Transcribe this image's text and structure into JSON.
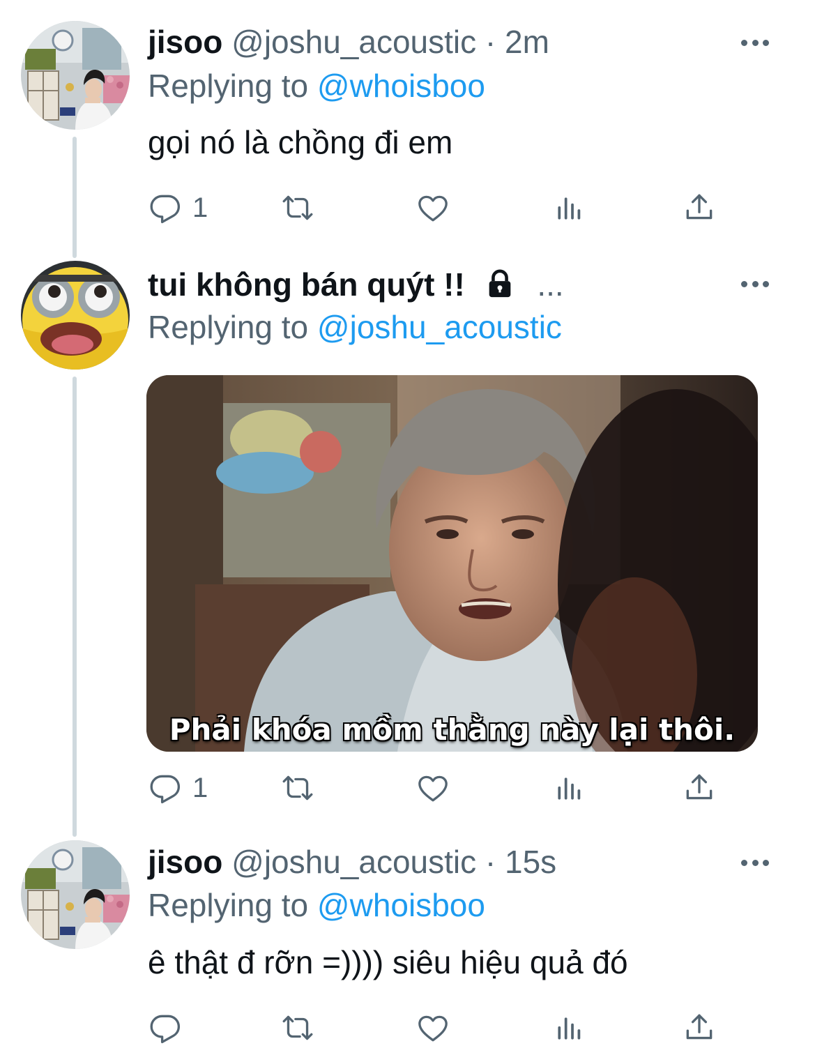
{
  "thread": [
    {
      "display_name": "jisoo",
      "handle": "@joshu_acoustic",
      "separator": "·",
      "time": "2m",
      "replying_prefix": "Replying to",
      "replying_to": "@whoisboo",
      "text": "gọi nó là chồng đi em",
      "reply_count": "1",
      "avatar_icon": "person-avatar"
    },
    {
      "display_name": "tui không bán quýt !!",
      "truncation": "...",
      "protected_icon": "lock-icon",
      "replying_prefix": "Replying to",
      "replying_to": "@joshu_acoustic",
      "media_caption": "Phải khóa mồm thằng này lại thôi.",
      "reply_count": "1",
      "avatar_icon": "cartoon-avatar"
    },
    {
      "display_name": "jisoo",
      "handle": "@joshu_acoustic",
      "separator": "·",
      "time": "15s",
      "replying_prefix": "Replying to",
      "replying_to": "@whoisboo",
      "text": "ê thật đ rỡn =)))) siêu hiệu quả đó",
      "reply_count": "",
      "avatar_icon": "person-avatar"
    }
  ],
  "colors": {
    "text": "#0f1419",
    "secondary": "#536471",
    "link": "#1d9bf0",
    "thread_line": "#cfd9de"
  }
}
